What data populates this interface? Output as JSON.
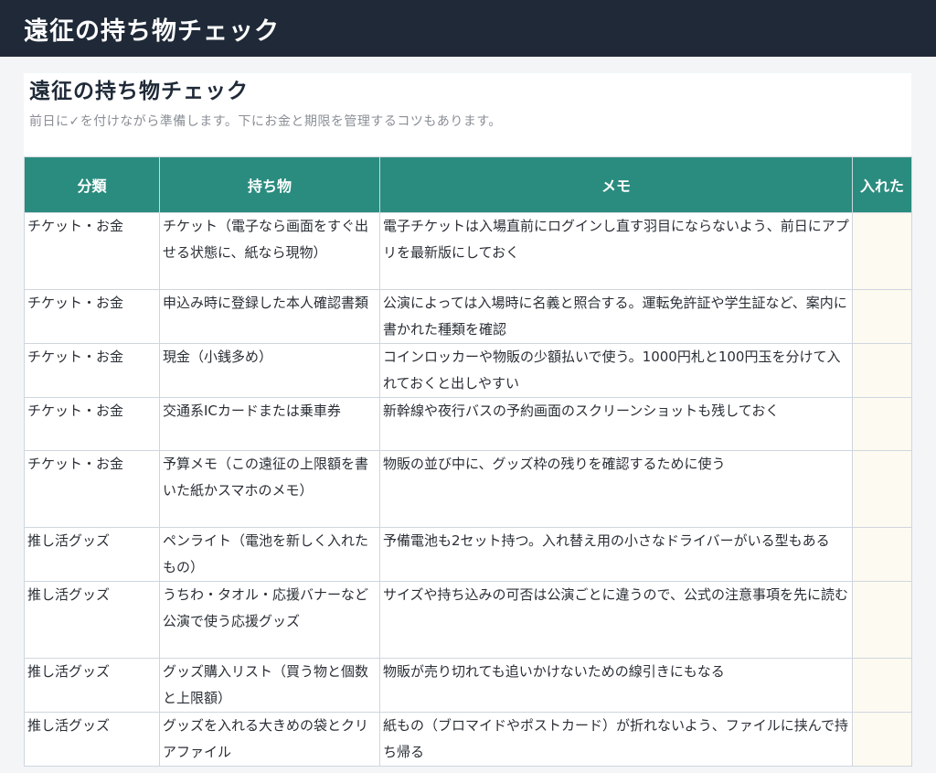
{
  "app": {
    "title": "遠征の持ち物チェック"
  },
  "header": {
    "title": "遠征の持ち物チェック",
    "subtitle": "前日に✓を付けながら準備します。下にお金と期限を管理するコツもあります。"
  },
  "table": {
    "columns": [
      "分類",
      "持ち物",
      "メモ",
      "入れた"
    ],
    "rows": [
      {
        "category": "チケット・お金",
        "item": "チケット（電子なら画面をすぐ出せる状態に、紙なら現物）",
        "memo": "電子チケットは入場直前にログインし直す羽目にならないよう、前日にアプリを最新版にしておく",
        "checked": ""
      },
      {
        "category": "チケット・お金",
        "item": "申込み時に登録した本人確認書類",
        "memo": "公演によっては入場時に名義と照合する。運転免許証や学生証など、案内に書かれた種類を確認",
        "checked": ""
      },
      {
        "category": "チケット・お金",
        "item": "現金（小銭多め）",
        "memo": "コインロッカーや物販の少額払いで使う。1000円札と100円玉を分けて入れておくと出しやすい",
        "checked": ""
      },
      {
        "category": "チケット・お金",
        "item": "交通系ICカードまたは乗車券",
        "memo": "新幹線や夜行バスの予約画面のスクリーンショットも残しておく",
        "checked": ""
      },
      {
        "category": "チケット・お金",
        "item": "予算メモ（この遠征の上限額を書いた紙かスマホのメモ）",
        "memo": "物販の並び中に、グッズ枠の残りを確認するために使う",
        "checked": ""
      },
      {
        "category": "推し活グッズ",
        "item": "ペンライト（電池を新しく入れたもの）",
        "memo": "予備電池も2セット持つ。入れ替え用の小さなドライバーがいる型もある",
        "checked": ""
      },
      {
        "category": "推し活グッズ",
        "item": "うちわ・タオル・応援バナーなど公演で使う応援グッズ",
        "memo": "サイズや持ち込みの可否は公演ごとに違うので、公式の注意事項を先に読む",
        "checked": ""
      },
      {
        "category": "推し活グッズ",
        "item": "グッズ購入リスト（買う物と個数と上限額）",
        "memo": "物販が売り切れても追いかけないための線引きにもなる",
        "checked": ""
      },
      {
        "category": "推し活グッズ",
        "item": "グッズを入れる大きめの袋とクリアファイル",
        "memo": "紙もの（ブロマイドやポストカード）が折れないよう、ファイルに挟んで持ち帰る",
        "checked": ""
      }
    ]
  },
  "colors": {
    "topbar": "#1f2937",
    "table_header": "#2a8c7e",
    "check_cell": "#fdfaf1"
  }
}
